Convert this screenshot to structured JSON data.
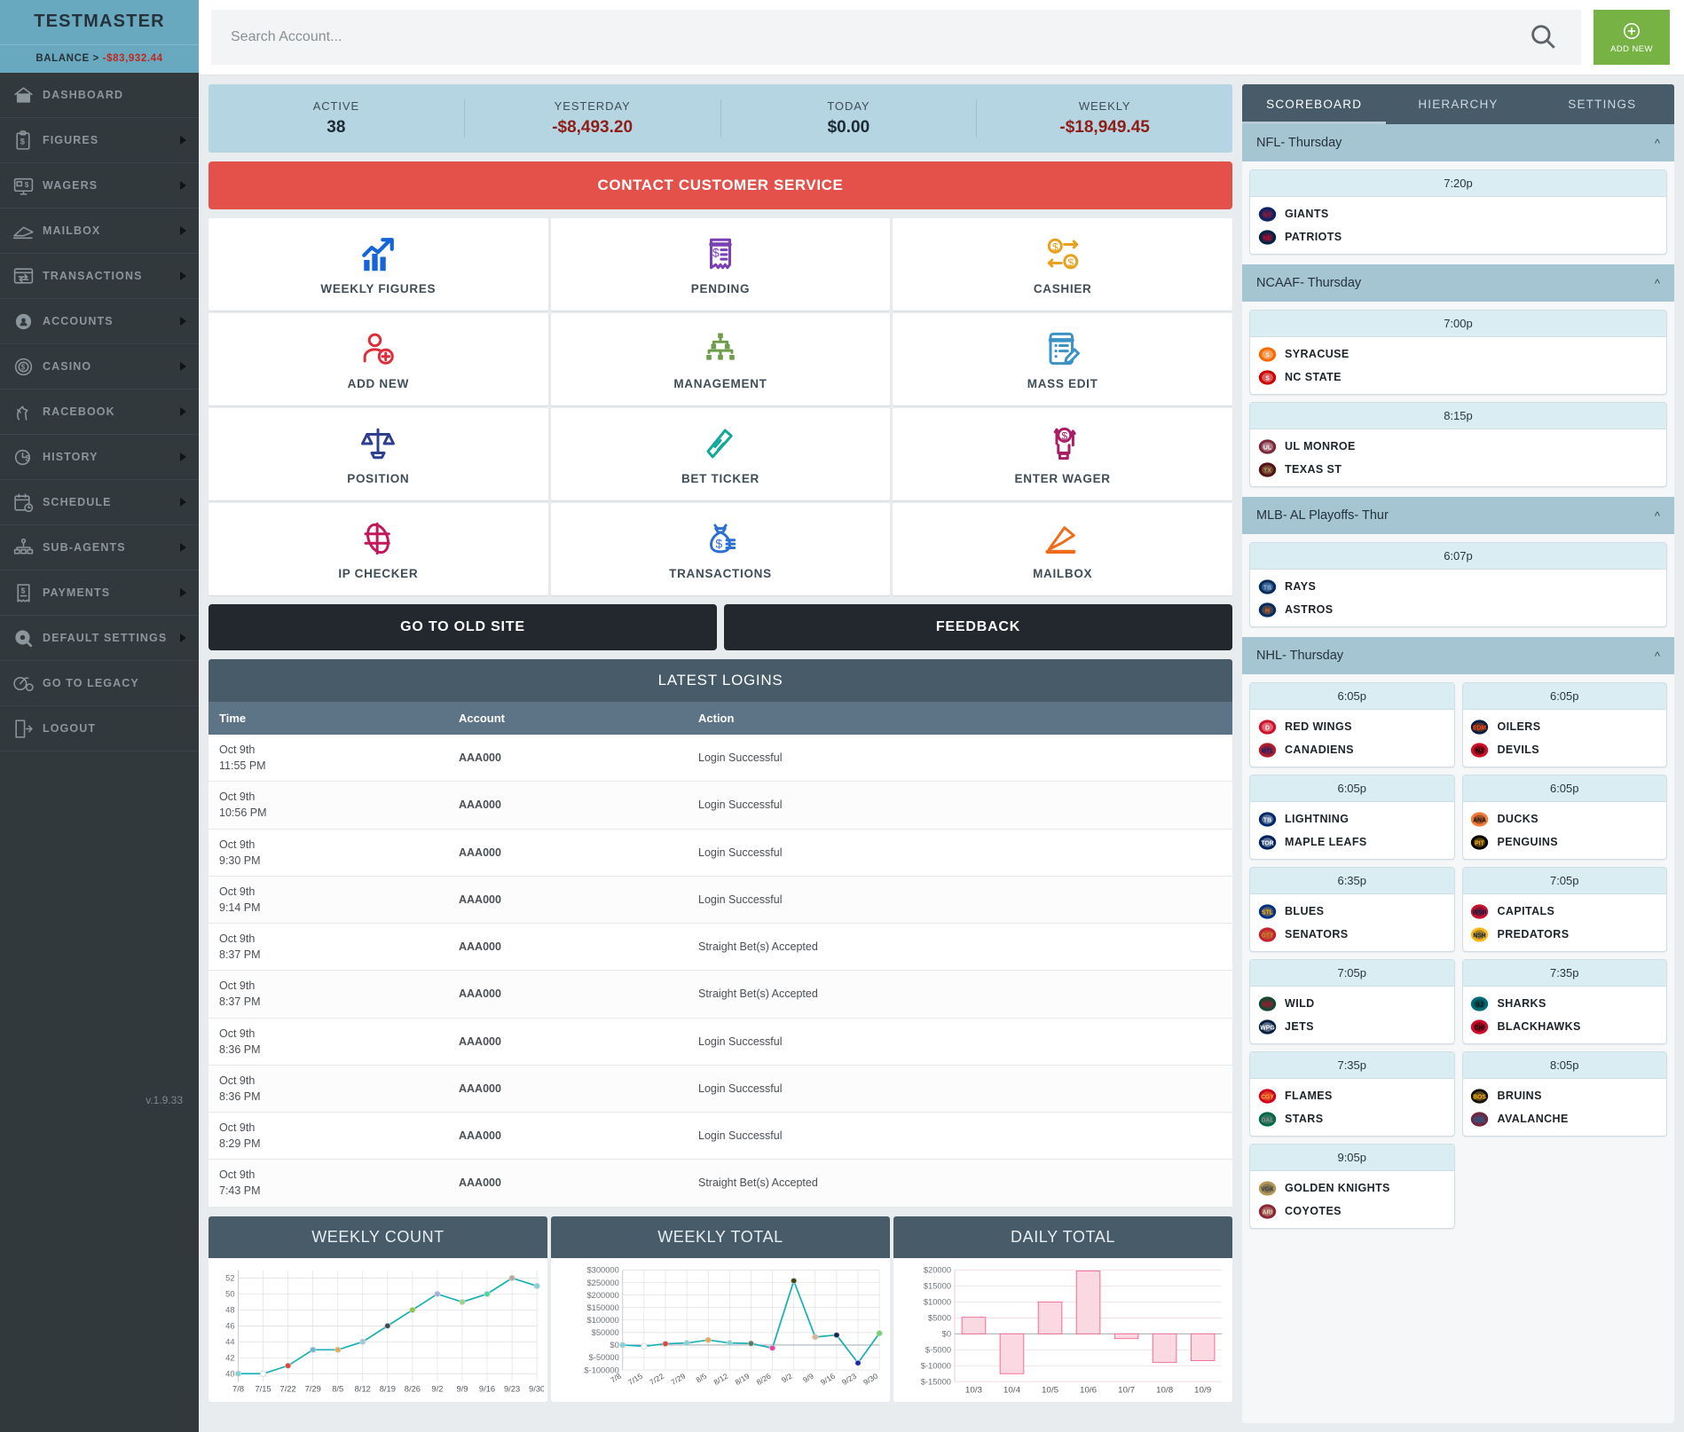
{
  "sidebar": {
    "brand": "TESTMASTER",
    "balance_label": "BALANCE >",
    "balance_value": "-$83,932.44",
    "version": "v.1.9.33",
    "items": [
      {
        "label": "DASHBOARD",
        "icon": "home-icon",
        "caret": false
      },
      {
        "label": "FIGURES",
        "icon": "clipboard-dollar-icon",
        "caret": true
      },
      {
        "label": "WAGERS",
        "icon": "monitor-dollar-icon",
        "caret": true
      },
      {
        "label": "MAILBOX",
        "icon": "envelope-icon",
        "caret": true
      },
      {
        "label": "TRANSACTIONS",
        "icon": "exchange-window-icon",
        "caret": true
      },
      {
        "label": "ACCOUNTS",
        "icon": "gear-user-icon",
        "caret": true
      },
      {
        "label": "CASINO",
        "icon": "poker-chip-icon",
        "caret": true
      },
      {
        "label": "RACEBOOK",
        "icon": "horse-icon",
        "caret": true
      },
      {
        "label": "HISTORY",
        "icon": "clock-dollar-icon",
        "caret": true
      },
      {
        "label": "SCHEDULE",
        "icon": "calendar-clock-icon",
        "caret": true
      },
      {
        "label": "SUB-AGENTS",
        "icon": "org-tree-icon",
        "caret": true
      },
      {
        "label": "PAYMENTS",
        "icon": "receipt-dollar-icon",
        "caret": true
      },
      {
        "label": "DEFAULT SETTINGS",
        "icon": "gear-wrench-icon",
        "caret": true
      },
      {
        "label": "GO TO LEGACY",
        "icon": "penny-farthing-icon",
        "caret": false
      },
      {
        "label": "LOGOUT",
        "icon": "logout-icon",
        "caret": false
      }
    ]
  },
  "topbar": {
    "search_placeholder": "Search Account...",
    "search_value": "",
    "search_icon": "search-icon",
    "add_new_label": "ADD NEW",
    "add_new_icon": "plus-circle-icon"
  },
  "stats": [
    {
      "label": "ACTIVE",
      "value": "38",
      "negative": false
    },
    {
      "label": "YESTERDAY",
      "value": "-$8,493.20",
      "negative": true
    },
    {
      "label": "TODAY",
      "value": "$0.00",
      "negative": false
    },
    {
      "label": "WEEKLY",
      "value": "-$18,949.45",
      "negative": true
    }
  ],
  "contact_banner": "CONTACT CUSTOMER SERVICE",
  "quick_tiles": [
    {
      "label": "WEEKLY FIGURES",
      "icon": "bar-chart-arrow-icon",
      "color": "#1565d8"
    },
    {
      "label": "PENDING",
      "icon": "receipt-pending-icon",
      "color": "#7b3fb5"
    },
    {
      "label": "CASHIER",
      "icon": "money-exchange-icon",
      "color": "#e8a01d"
    },
    {
      "label": "ADD NEW",
      "icon": "user-plus-icon",
      "color": "#e02d3c"
    },
    {
      "label": "MANAGEMENT",
      "icon": "org-chart-icon",
      "color": "#6f9c4a"
    },
    {
      "label": "MASS EDIT",
      "icon": "document-pencil-icon",
      "color": "#3a93c4"
    },
    {
      "label": "POSITION",
      "icon": "scales-icon",
      "color": "#2e3f8f"
    },
    {
      "label": "BET TICKER",
      "icon": "ticket-icon",
      "color": "#12a89d"
    },
    {
      "label": "ENTER WAGER",
      "icon": "hand-money-icon",
      "color": "#a81d64"
    },
    {
      "label": "IP CHECKER",
      "icon": "globe-icon",
      "color": "#c2185b"
    },
    {
      "label": "TRANSACTIONS",
      "icon": "money-bag-icon",
      "color": "#2d6fd4"
    },
    {
      "label": "MAILBOX",
      "icon": "envelope-open-icon",
      "color": "#ef6c1a"
    }
  ],
  "dual_buttons": {
    "old_site": "GO TO OLD SITE",
    "feedback": "FEEDBACK"
  },
  "latest_logins": {
    "title": "LATEST LOGINS",
    "columns": [
      "Time",
      "Account",
      "Action"
    ],
    "rows": [
      {
        "date": "Oct 9th",
        "time": "11:55 PM",
        "account": "AAA000",
        "action": "Login Successful"
      },
      {
        "date": "Oct 9th",
        "time": "10:56 PM",
        "account": "AAA000",
        "action": "Login Successful"
      },
      {
        "date": "Oct 9th",
        "time": "9:30 PM",
        "account": "AAA000",
        "action": "Login Successful"
      },
      {
        "date": "Oct 9th",
        "time": "9:14 PM",
        "account": "AAA000",
        "action": "Login Successful"
      },
      {
        "date": "Oct 9th",
        "time": "8:37 PM",
        "account": "AAA000",
        "action": "Straight Bet(s) Accepted"
      },
      {
        "date": "Oct 9th",
        "time": "8:37 PM",
        "account": "AAA000",
        "action": "Straight Bet(s) Accepted"
      },
      {
        "date": "Oct 9th",
        "time": "8:36 PM",
        "account": "AAA000",
        "action": "Login Successful"
      },
      {
        "date": "Oct 9th",
        "time": "8:36 PM",
        "account": "AAA000",
        "action": "Login Successful"
      },
      {
        "date": "Oct 9th",
        "time": "8:29 PM",
        "account": "AAA000",
        "action": "Login Successful"
      },
      {
        "date": "Oct 9th",
        "time": "7:43 PM",
        "account": "AAA000",
        "action": "Straight Bet(s) Accepted"
      }
    ]
  },
  "chart_data": [
    {
      "type": "line",
      "title": "WEEKLY COUNT",
      "xlabel": "",
      "ylabel": "",
      "categories": [
        "7/8",
        "7/15",
        "7/22",
        "7/29",
        "8/5",
        "8/12",
        "8/19",
        "8/26",
        "9/2",
        "9/9",
        "9/16",
        "9/23",
        "9/30"
      ],
      "values": [
        40,
        40,
        41,
        43,
        43,
        44,
        46,
        48,
        50,
        49,
        50,
        52,
        51
      ],
      "yticks": [
        40,
        42,
        44,
        46,
        48,
        50,
        52
      ],
      "ylim": [
        39,
        53
      ],
      "grid": true,
      "legend": "none",
      "line_color": "#19b0b5",
      "point_colors": [
        "#7fd4d8",
        "#ffffff",
        "#e8413a",
        "#6db7d4",
        "#e8a94c",
        "#9ec9d8",
        "#3c4a52",
        "#8ec63f",
        "#a8aede",
        "#9bd48a",
        "#47d99a",
        "#b7a89a",
        "#7fd4d8"
      ]
    },
    {
      "type": "line",
      "title": "WEEKLY TOTAL",
      "xlabel": "",
      "ylabel": "",
      "categories": [
        "7/8",
        "7/15",
        "7/22",
        "7/29",
        "8/5",
        "8/12",
        "8/19",
        "8/26",
        "9/2",
        "9/9",
        "9/16",
        "9/23",
        "9/30"
      ],
      "values": [
        0,
        -5000,
        5000,
        8000,
        20000,
        8000,
        6000,
        -12000,
        257000,
        32000,
        40000,
        -72000,
        47000
      ],
      "yticks": [
        -100000,
        -50000,
        0,
        50000,
        100000,
        150000,
        200000,
        250000,
        300000
      ],
      "yticklabels": [
        "$-100000",
        "$-50000",
        "$0",
        "$50000",
        "$100000",
        "$150000",
        "$200000",
        "$250000",
        "$300000"
      ],
      "ylim": [
        -100000,
        300000
      ],
      "grid": true,
      "legend": "none",
      "line_color": "#19b0b5",
      "point_colors": [
        "#7fd4d8",
        "#ffffff",
        "#e8413a",
        "#7fd4d8",
        "#e8a94c",
        "#7fd4d8",
        "#5a7a6a",
        "#ef3fa0",
        "#3a4a12",
        "#d9b48a",
        "#16234a",
        "#2026a8",
        "#6fd36f"
      ]
    },
    {
      "type": "bar",
      "title": "DAILY TOTAL",
      "xlabel": "",
      "ylabel": "",
      "categories": [
        "10/3",
        "10/4",
        "10/5",
        "10/6",
        "10/7",
        "10/8",
        "10/9"
      ],
      "values": [
        5200,
        -12500,
        10000,
        19700,
        -1500,
        -9000,
        -8400
      ],
      "yticks": [
        -15000,
        -10000,
        -5000,
        0,
        5000,
        10000,
        15000,
        20000
      ],
      "yticklabels": [
        "$-15000",
        "$-10000",
        "$-5000",
        "$0",
        "$5000",
        "$10000",
        "$15000",
        "$20000"
      ],
      "ylim": [
        -15000,
        20000
      ],
      "grid": true,
      "legend": "none",
      "bar_fill": "#fbd9e2",
      "bar_stroke": "#f25f8a"
    }
  ],
  "right_panel": {
    "tabs": [
      {
        "label": "SCOREBOARD",
        "active": true
      },
      {
        "label": "HIERARCHY",
        "active": false
      },
      {
        "label": "SETTINGS",
        "active": false
      }
    ],
    "leagues": [
      {
        "name": "NFL- Thursday",
        "collapse_icon": "chevron-up-icon",
        "columns": 1,
        "games": [
          {
            "time": "7:20p",
            "teams": [
              {
                "name": "GIANTS",
                "logo": "ny-giants-logo"
              },
              {
                "name": "PATRIOTS",
                "logo": "patriots-logo"
              }
            ]
          }
        ]
      },
      {
        "name": "NCAAF- Thursday",
        "collapse_icon": "chevron-up-icon",
        "columns": 1,
        "games": [
          {
            "time": "7:00p",
            "teams": [
              {
                "name": "SYRACUSE",
                "logo": "syracuse-logo"
              },
              {
                "name": "NC STATE",
                "logo": "nc-state-logo"
              }
            ]
          },
          {
            "time": "8:15p",
            "teams": [
              {
                "name": "UL MONROE",
                "logo": "ul-monroe-logo"
              },
              {
                "name": "TEXAS ST",
                "logo": "texas-state-logo"
              }
            ]
          }
        ]
      },
      {
        "name": "MLB- AL Playoffs- Thur",
        "collapse_icon": "chevron-up-icon",
        "columns": 1,
        "games": [
          {
            "time": "6:07p",
            "teams": [
              {
                "name": "RAYS",
                "logo": "rays-logo"
              },
              {
                "name": "ASTROS",
                "logo": "astros-logo"
              }
            ]
          }
        ]
      },
      {
        "name": "NHL- Thursday",
        "collapse_icon": "chevron-up-icon",
        "columns": 2,
        "games": [
          {
            "time": "6:05p",
            "teams": [
              {
                "name": "RED WINGS",
                "logo": "red-wings-logo"
              },
              {
                "name": "CANADIENS",
                "logo": "canadiens-logo"
              }
            ]
          },
          {
            "time": "6:05p",
            "teams": [
              {
                "name": "OILERS",
                "logo": "oilers-logo"
              },
              {
                "name": "DEVILS",
                "logo": "devils-logo"
              }
            ]
          },
          {
            "time": "6:05p",
            "teams": [
              {
                "name": "LIGHTNING",
                "logo": "lightning-logo"
              },
              {
                "name": "MAPLE LEAFS",
                "logo": "maple-leafs-logo"
              }
            ]
          },
          {
            "time": "6:05p",
            "teams": [
              {
                "name": "DUCKS",
                "logo": "ducks-logo"
              },
              {
                "name": "PENGUINS",
                "logo": "penguins-logo"
              }
            ]
          },
          {
            "time": "6:35p",
            "teams": [
              {
                "name": "BLUES",
                "logo": "blues-logo"
              },
              {
                "name": "SENATORS",
                "logo": "senators-logo"
              }
            ]
          },
          {
            "time": "7:05p",
            "teams": [
              {
                "name": "CAPITALS",
                "logo": "capitals-logo"
              },
              {
                "name": "PREDATORS",
                "logo": "predators-logo"
              }
            ]
          },
          {
            "time": "7:05p",
            "teams": [
              {
                "name": "WILD",
                "logo": "wild-logo"
              },
              {
                "name": "JETS",
                "logo": "jets-logo"
              }
            ]
          },
          {
            "time": "7:35p",
            "teams": [
              {
                "name": "SHARKS",
                "logo": "sharks-logo"
              },
              {
                "name": "BLACKHAWKS",
                "logo": "blackhawks-logo"
              }
            ]
          },
          {
            "time": "7:35p",
            "teams": [
              {
                "name": "FLAMES",
                "logo": "flames-logo"
              },
              {
                "name": "STARS",
                "logo": "stars-logo"
              }
            ]
          },
          {
            "time": "8:05p",
            "teams": [
              {
                "name": "BRUINS",
                "logo": "bruins-logo"
              },
              {
                "name": "AVALANCHE",
                "logo": "avalanche-logo"
              }
            ]
          },
          {
            "time": "9:05p",
            "teams": [
              {
                "name": "GOLDEN KNIGHTS",
                "logo": "golden-knights-logo"
              },
              {
                "name": "COYOTES",
                "logo": "coyotes-logo"
              }
            ]
          }
        ]
      }
    ]
  }
}
